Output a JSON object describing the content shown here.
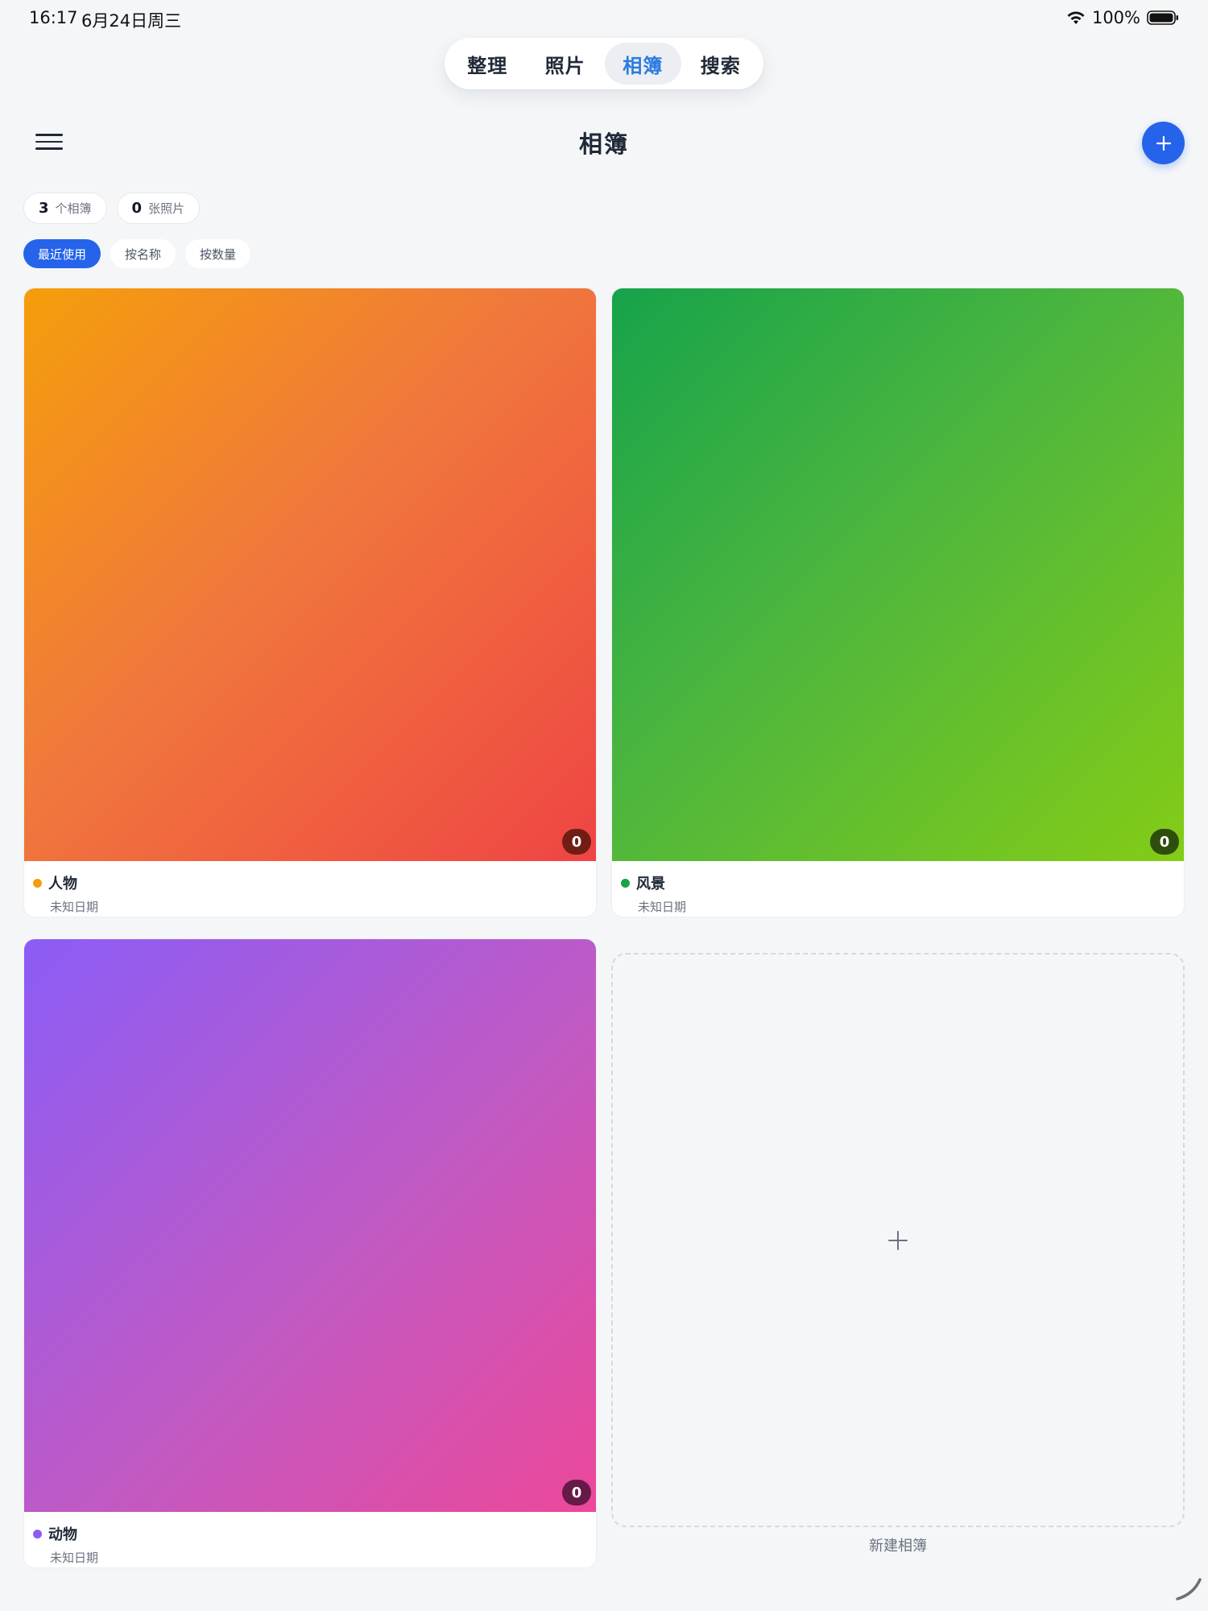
{
  "status_bar": {
    "time": "16:17",
    "date": "6月24日周三",
    "battery_text": "100%"
  },
  "nav": {
    "tabs": [
      {
        "label": "整理",
        "active": false
      },
      {
        "label": "照片",
        "active": false
      },
      {
        "label": "相簿",
        "active": true
      },
      {
        "label": "搜索",
        "active": false
      }
    ]
  },
  "header": {
    "title": "相簿",
    "menu_icon": "hamburger-menu-icon",
    "add_icon": "plus-icon"
  },
  "stats": [
    {
      "value": "3",
      "label": "个相簿"
    },
    {
      "value": "0",
      "label": "张照片"
    }
  ],
  "sort": {
    "options": [
      {
        "label": "最近使用",
        "active": true
      },
      {
        "label": "按名称",
        "active": false
      },
      {
        "label": "按数量",
        "active": false
      }
    ]
  },
  "albums": [
    {
      "name": "人物",
      "date": "未知日期",
      "count": "0",
      "dot_color": "#f59e0b"
    },
    {
      "name": "风景",
      "date": "未知日期",
      "count": "0",
      "dot_color": "#16a34a"
    },
    {
      "name": "动物",
      "date": "未知日期",
      "count": "0",
      "dot_color": "#8b5cf6"
    }
  ],
  "new_album": {
    "label": "新建相簿",
    "icon": "plus-icon"
  },
  "colors": {
    "accent": "#2563eb",
    "active_tab_text": "#2b7be0",
    "background": "#f4f6f8"
  }
}
